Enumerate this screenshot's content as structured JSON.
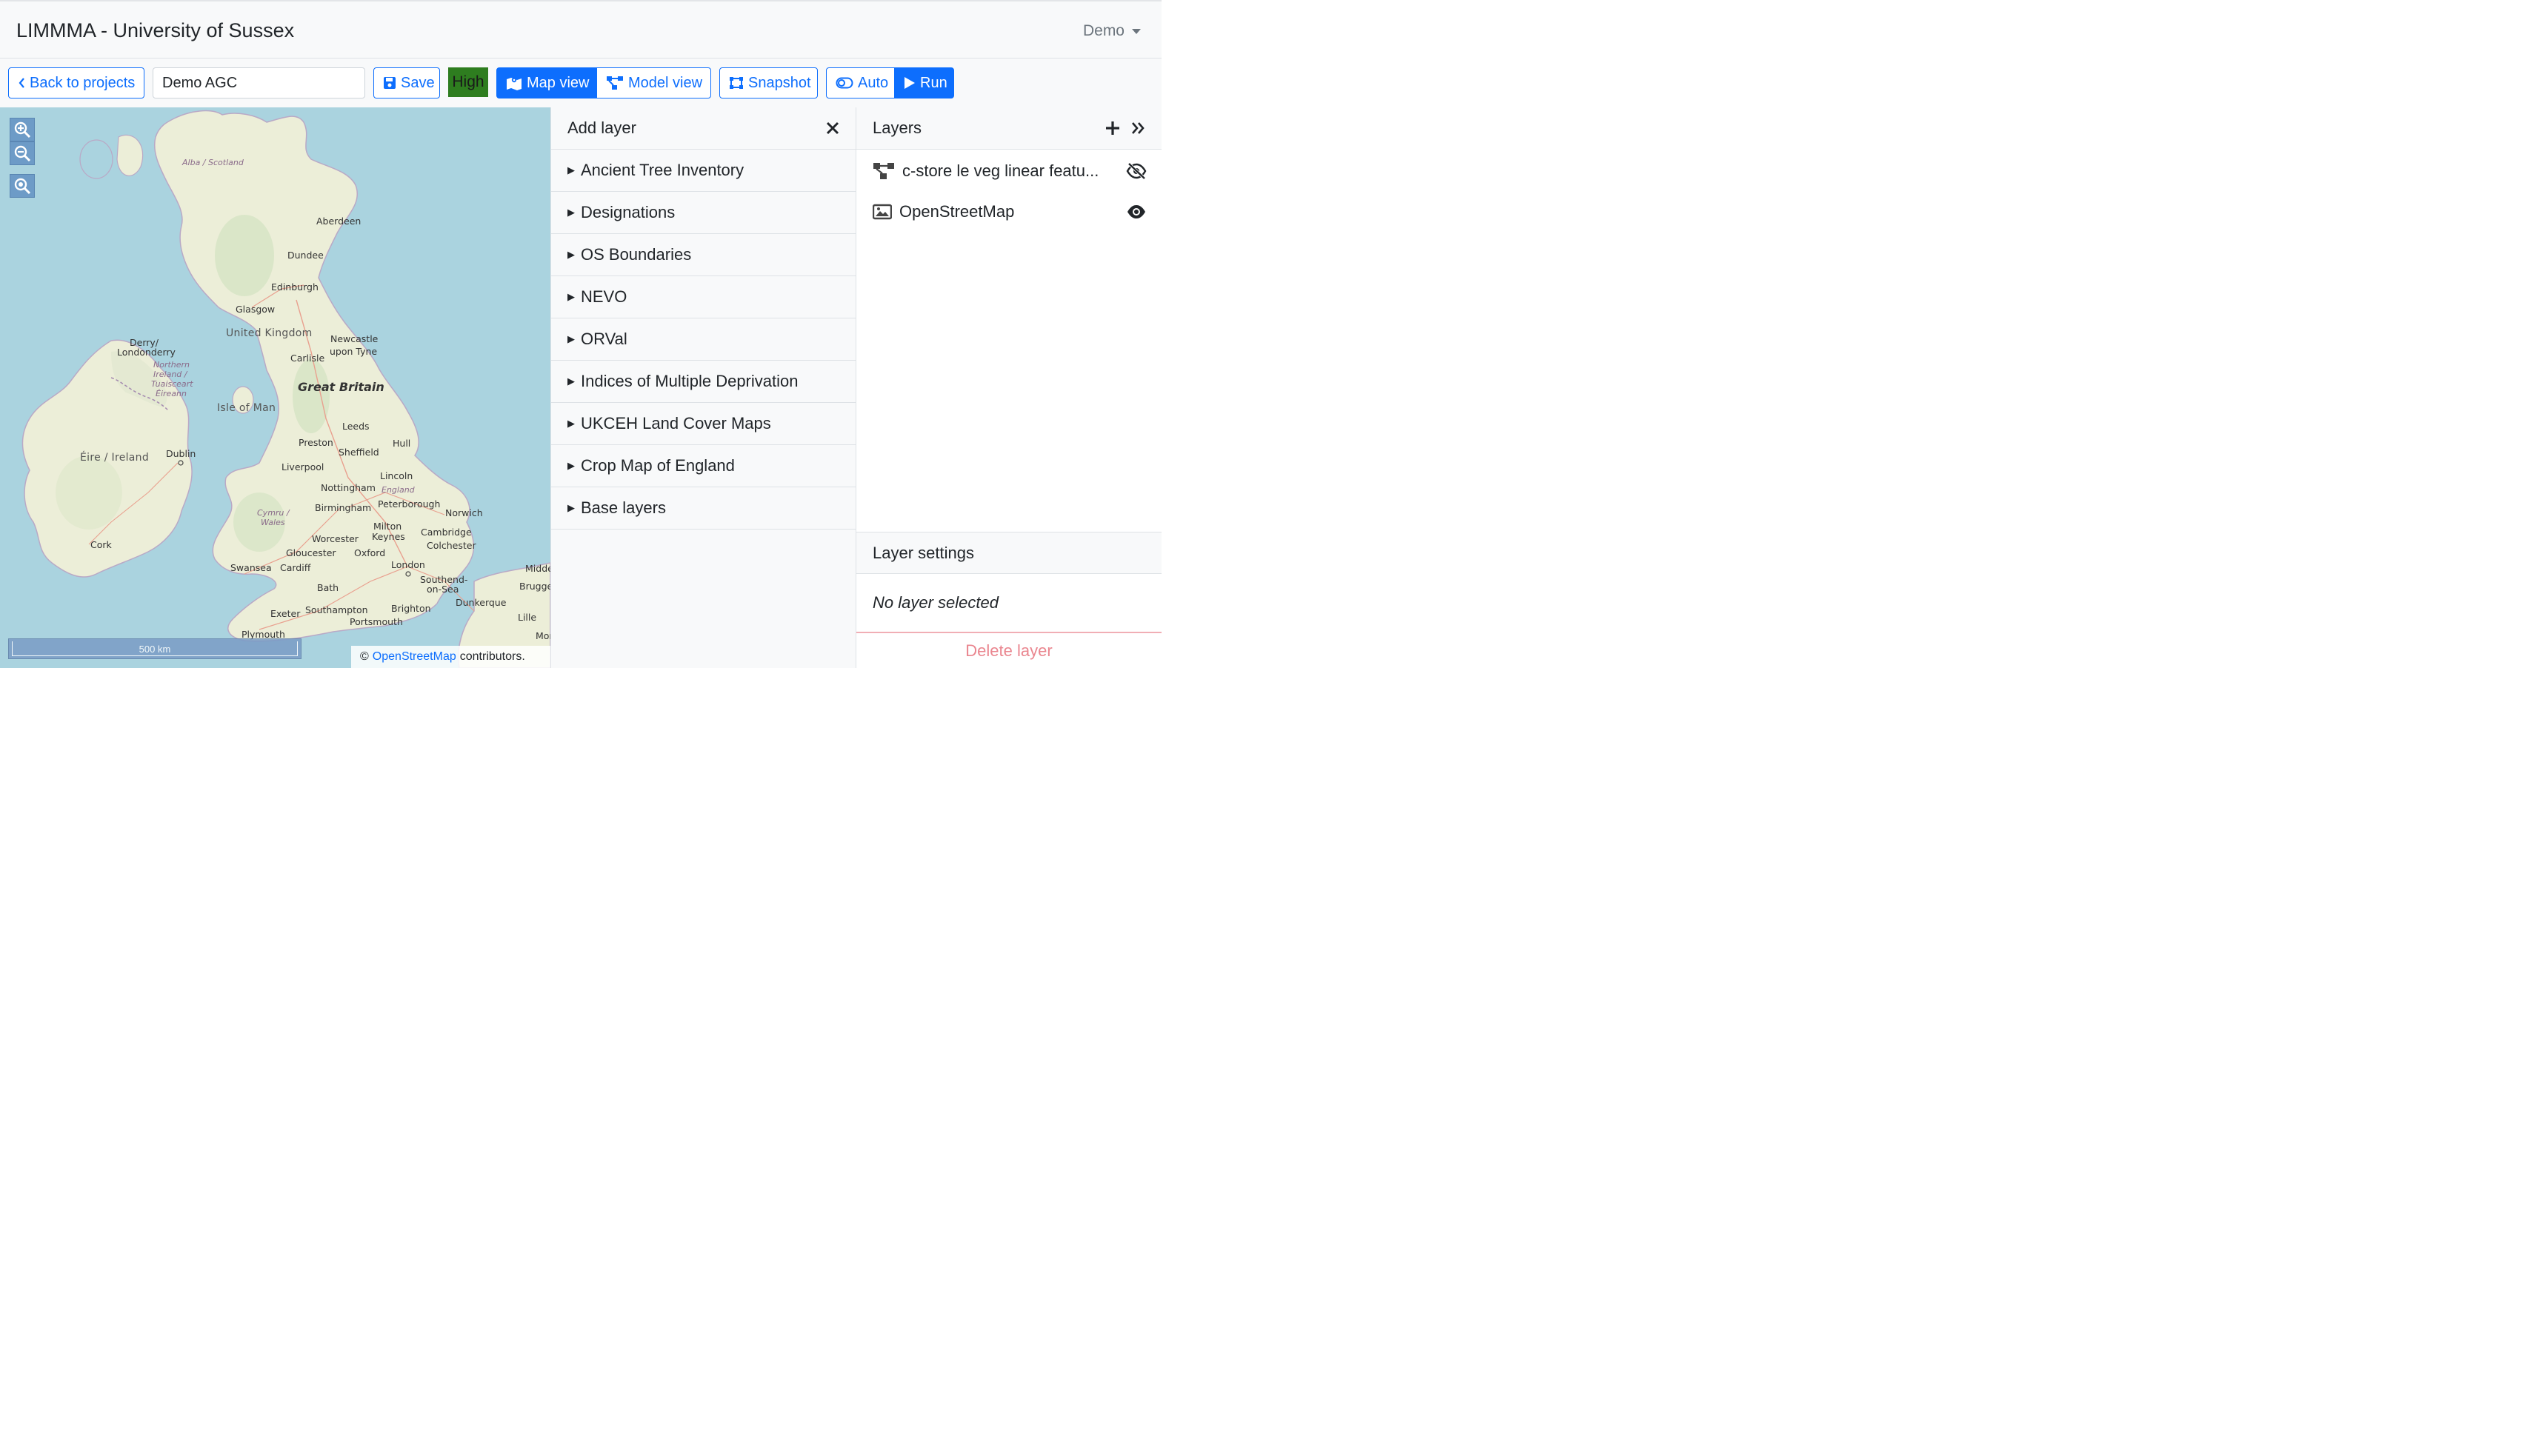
{
  "app": {
    "title": "LIMMMA - University of Sussex",
    "user": "Demo"
  },
  "toolbar": {
    "back_label": "Back to projects",
    "project_name": "Demo AGC",
    "save_label": "Save",
    "quality": "High",
    "quality_color": "#2e7d1f",
    "map_view_label": "Map view",
    "model_view_label": "Model view",
    "snapshot_label": "Snapshot",
    "auto_label": "Auto",
    "run_label": "Run",
    "accent": "#0d6efd"
  },
  "map": {
    "labels": {
      "alba": "Alba / Scotland",
      "aberdeen": "Aberdeen",
      "dundee": "Dundee",
      "edinburgh": "Edinburgh",
      "glasgow": "Glasgow",
      "uk": "United Kingdom",
      "derry": "Derry/",
      "londonderry": "Londonderry",
      "ni1": "Northern",
      "ni2": "Ireland /",
      "ni3": "Tuaisceart",
      "ni4": "Éireann",
      "newcastle1": "Newcastle",
      "newcastle2": "upon Tyne",
      "carlisle": "Carlisle",
      "great_britain": "Great Britain",
      "isle_of_man": "Isle of Man",
      "leeds": "Leeds",
      "preston": "Preston",
      "hull": "Hull",
      "sheffield": "Sheffield",
      "eire": "Éire / Ireland",
      "dublin": "Dublin",
      "liverpool": "Liverpool",
      "lincoln": "Lincoln",
      "nottingham": "Nottingham",
      "england": "England",
      "birmingham": "Birmingham",
      "peterborough": "Peterborough",
      "norwich": "Norwich",
      "cymru1": "Cymru /",
      "cymru2": "Wales",
      "milton1": "Milton",
      "milton2": "Keynes",
      "cambridge": "Cambridge",
      "worcester": "Worcester",
      "colchester": "Colchester",
      "cork": "Cork",
      "gloucester": "Gloucester",
      "oxford": "Oxford",
      "swansea": "Swansea",
      "cardiff": "Cardiff",
      "london": "London",
      "southend1": "Southend-",
      "southend2": "on-Sea",
      "bath": "Bath",
      "middel": "Middel",
      "brugge": "Brugge",
      "dunkerque": "Dunkerque",
      "southampton": "Southampton",
      "brighton": "Brighton",
      "exeter": "Exeter",
      "portsmouth": "Portsmouth",
      "lille": "Lille",
      "plymouth": "Plymouth",
      "mor": "Mor"
    },
    "scale": "500 km",
    "attribution_prefix": "©",
    "attribution_link": "OpenStreetMap",
    "attribution_suffix": "contributors."
  },
  "add_layer": {
    "title": "Add layer",
    "items": [
      "Ancient Tree Inventory",
      "Designations",
      "OS Boundaries",
      "NEVO",
      "ORVal",
      "Indices of Multiple Deprivation",
      "UKCEH Land Cover Maps",
      "Crop Map of England",
      "Base layers"
    ]
  },
  "layers": {
    "title": "Layers",
    "items": [
      {
        "name": "c-store le veg linear featu...",
        "icon": "graph-model-icon",
        "visible": false
      },
      {
        "name": "OpenStreetMap",
        "icon": "image-icon",
        "visible": true
      }
    ],
    "settings_title": "Layer settings",
    "no_selection": "No layer selected",
    "delete_label": "Delete layer",
    "delete_color": "#ea868f"
  }
}
